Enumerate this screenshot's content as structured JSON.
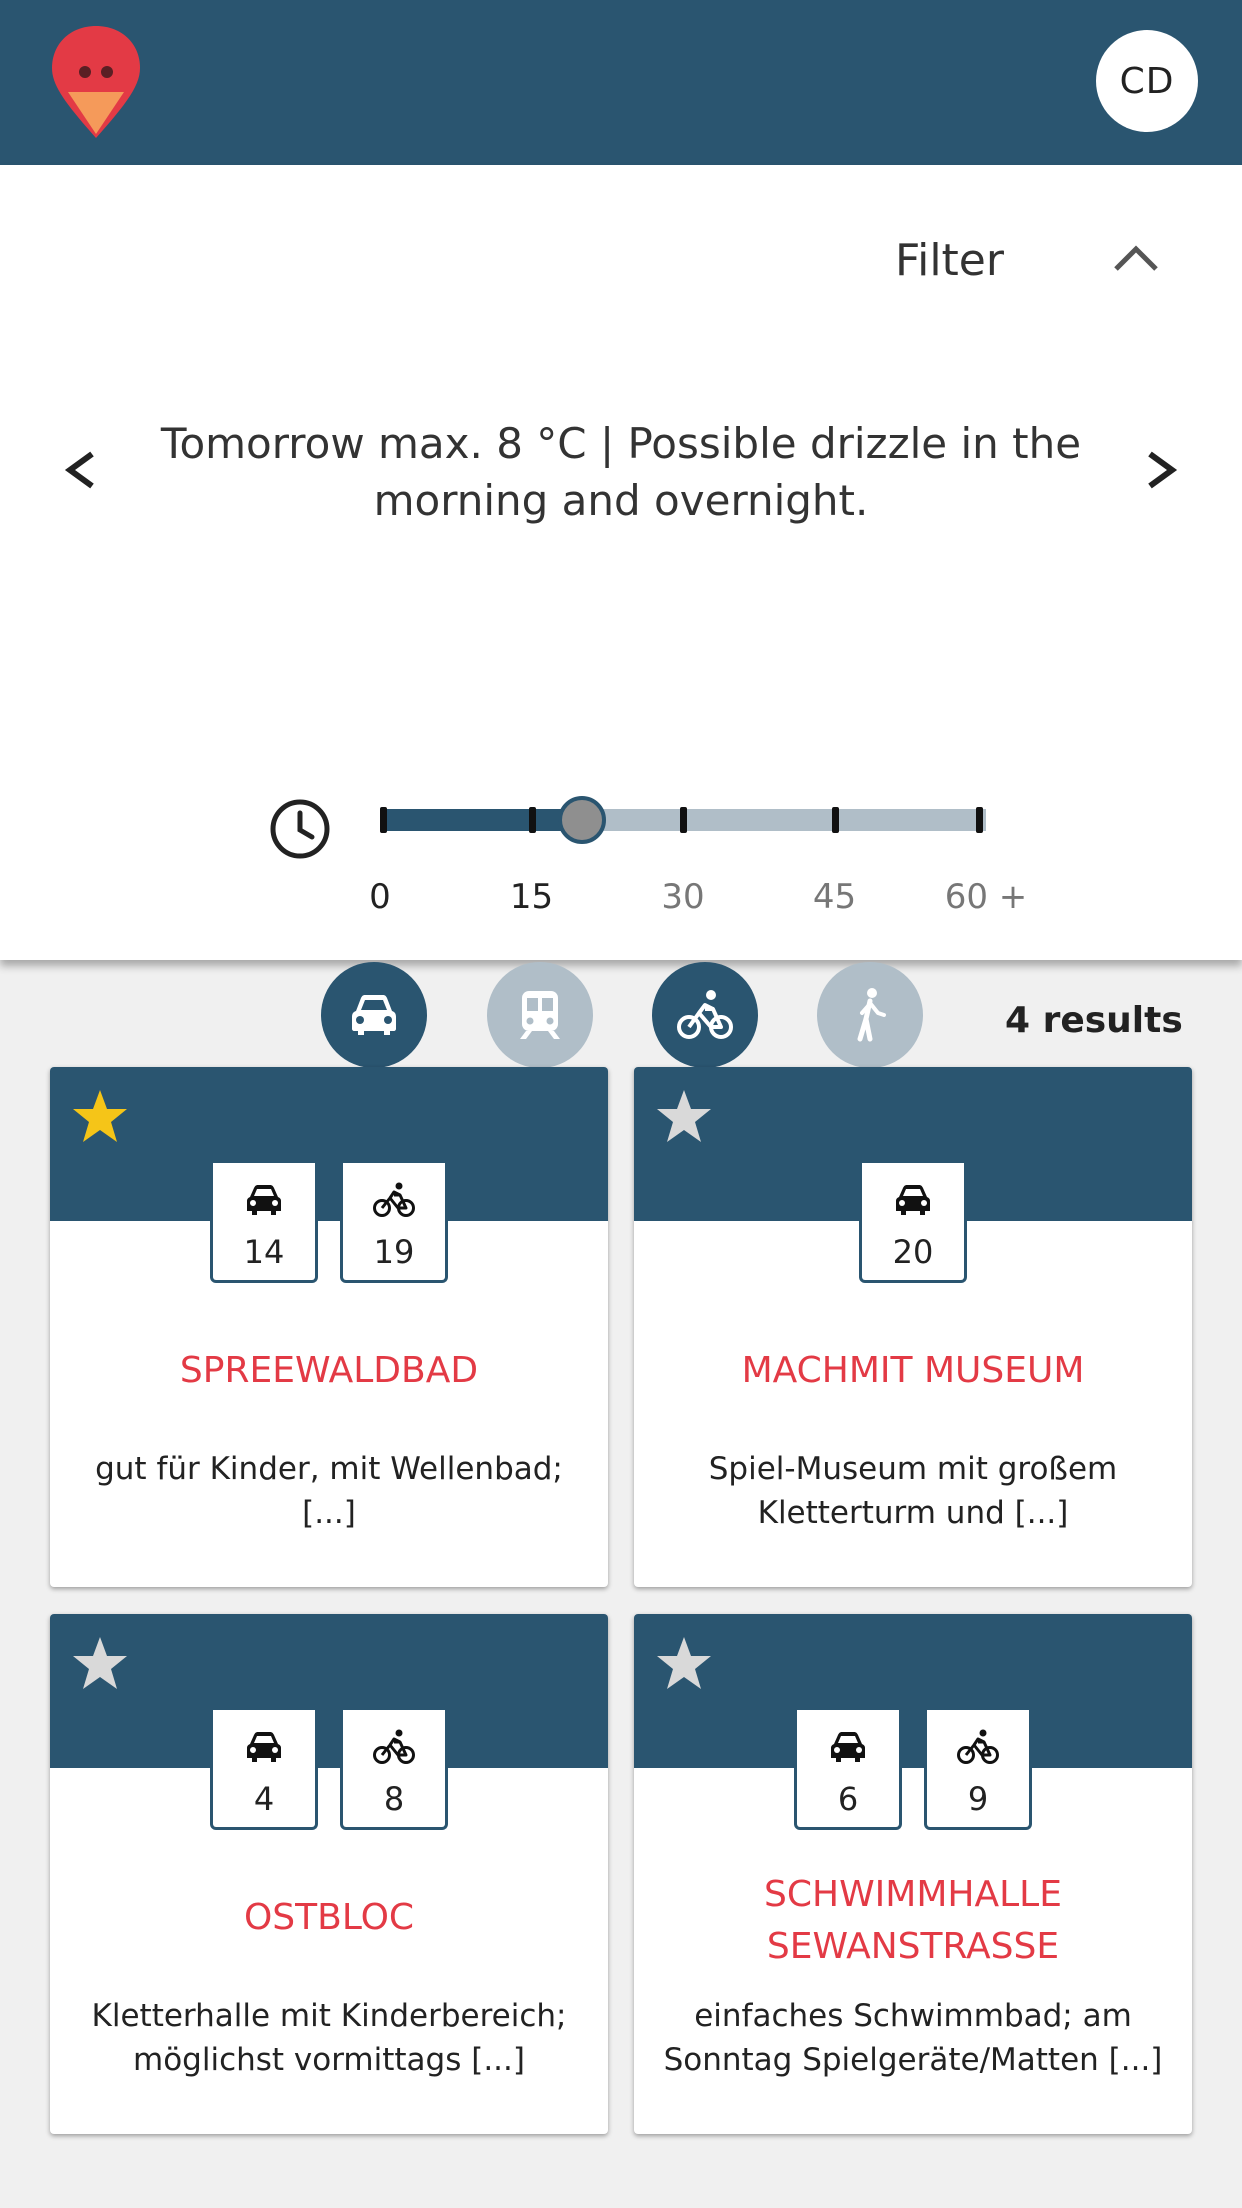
{
  "header": {
    "logo_icon": "pin-bird-logo",
    "avatar_initials": "CD"
  },
  "filter": {
    "label": "Filter",
    "expanded": true
  },
  "weather": {
    "text": "Tomorrow max. 8 °C | Possible drizzle in the morning and overnight."
  },
  "time_slider": {
    "ticks": [
      "0",
      "15",
      "30",
      "45",
      "60 +"
    ],
    "value_minutes": 20,
    "max_minutes": 60
  },
  "transport_modes": [
    {
      "name": "car",
      "icon": "car-icon",
      "active": true
    },
    {
      "name": "train",
      "icon": "train-icon",
      "active": false
    },
    {
      "name": "bike",
      "icon": "bike-icon",
      "active": true
    },
    {
      "name": "walk",
      "icon": "walk-icon",
      "active": false
    }
  ],
  "results_label": "4 results",
  "cards": [
    {
      "title": "SPREEWALDBAD",
      "description": "gut für Kinder, mit Wellenbad; [...]",
      "favorite": true,
      "travel": [
        {
          "mode": "car",
          "minutes": "14"
        },
        {
          "mode": "bike",
          "minutes": "19"
        }
      ]
    },
    {
      "title": "MACHMIT MUSEUM",
      "description": "Spiel-Museum mit großem Kletterturm und [...]",
      "favorite": false,
      "travel": [
        {
          "mode": "car",
          "minutes": "20"
        }
      ]
    },
    {
      "title": "OSTBLOC",
      "description": "Kletterhalle mit Kinderbereich; möglichst vormittags [...]",
      "favorite": false,
      "travel": [
        {
          "mode": "car",
          "minutes": "4"
        },
        {
          "mode": "bike",
          "minutes": "8"
        }
      ]
    },
    {
      "title": "SCHWIMMHALLE SEWANSTRASSE",
      "description": "einfaches Schwimmbad; am Sonntag Spielgeräte/Matten [...]",
      "favorite": false,
      "travel": [
        {
          "mode": "car",
          "minutes": "6"
        },
        {
          "mode": "bike",
          "minutes": "9"
        }
      ]
    }
  ],
  "colors": {
    "primary": "#2a5570",
    "accent": "#e33a45",
    "inactive": "#b0bec8",
    "star_active": "#f5c518",
    "star_inactive": "#d9d9d9"
  }
}
